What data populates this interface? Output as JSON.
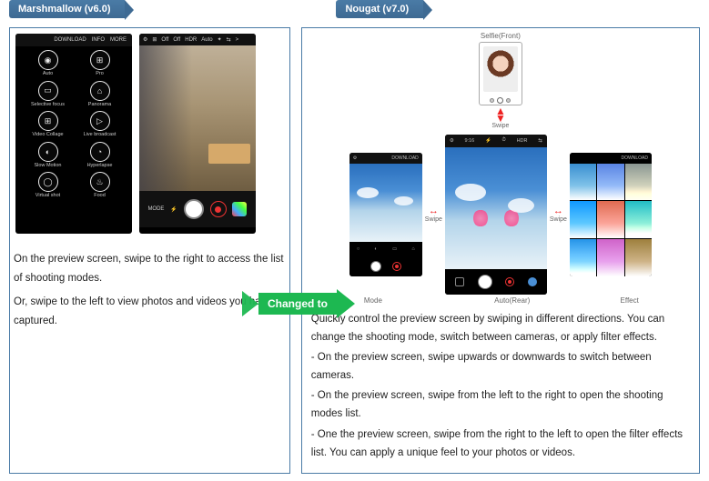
{
  "left": {
    "tab": "Marshmallow (v6.0)",
    "modes_top": {
      "download": "DOWNLOAD",
      "info": "INFO",
      "more": "MORE"
    },
    "modes": [
      {
        "icon": "◉",
        "label": "Auto"
      },
      {
        "icon": "⊞",
        "label": "Pro"
      },
      {
        "icon": "▭",
        "label": "Selective focus"
      },
      {
        "icon": "⌂",
        "label": "Panorama"
      },
      {
        "icon": "⊞",
        "label": "Video Collage"
      },
      {
        "icon": "▷",
        "label": "Live broadcast"
      },
      {
        "icon": "◐",
        "label": "Slow Motion"
      },
      {
        "icon": "◔",
        "label": "Hyperlapse"
      },
      {
        "icon": "◯",
        "label": "Virtual shot"
      },
      {
        "icon": "♨",
        "label": "Food"
      }
    ],
    "preview_top": [
      "⚙",
      "⊞",
      "Off",
      "Off",
      "HDR",
      "Auto",
      "✦",
      "⇆",
      ">"
    ],
    "preview_bottom": {
      "mode": "MODE",
      "flash": "⚡"
    },
    "desc1": "On the preview screen, swipe to the right to access the list of shooting modes.",
    "desc2": "Or, swipe to the left to view photos and videos you have captured."
  },
  "arrow": "Changed to",
  "right": {
    "tab": "Nougat (v7.0)",
    "selfie_label": "Selfie(Front)",
    "swipe": "Swipe",
    "mode_caption": "Mode",
    "auto_caption": "Auto(Rear)",
    "effect_caption": "Effect",
    "mode_top": {
      "left": "⚙",
      "right": "DOWNLOAD"
    },
    "auto_top": [
      "⚙",
      "9:16",
      "⚡",
      "⏱",
      "HDR",
      "⇆"
    ],
    "effect_top": "DOWNLOAD",
    "mini_mid_items": [
      "○",
      "◐",
      "▭",
      "⌂"
    ],
    "desc": [
      "Quickly control the preview screen by swiping in different directions. You can change the shooting mode, switch between cameras, or apply filter effects.",
      "- On the preview screen, swipe upwards or downwards to switch between cameras.",
      "- On the preview screen, swipe from the left to the right to open the shooting modes list.",
      "- One the preview screen, swipe from the right to the left to open the filter effects list. You can apply a unique feel to your photos or videos."
    ]
  }
}
